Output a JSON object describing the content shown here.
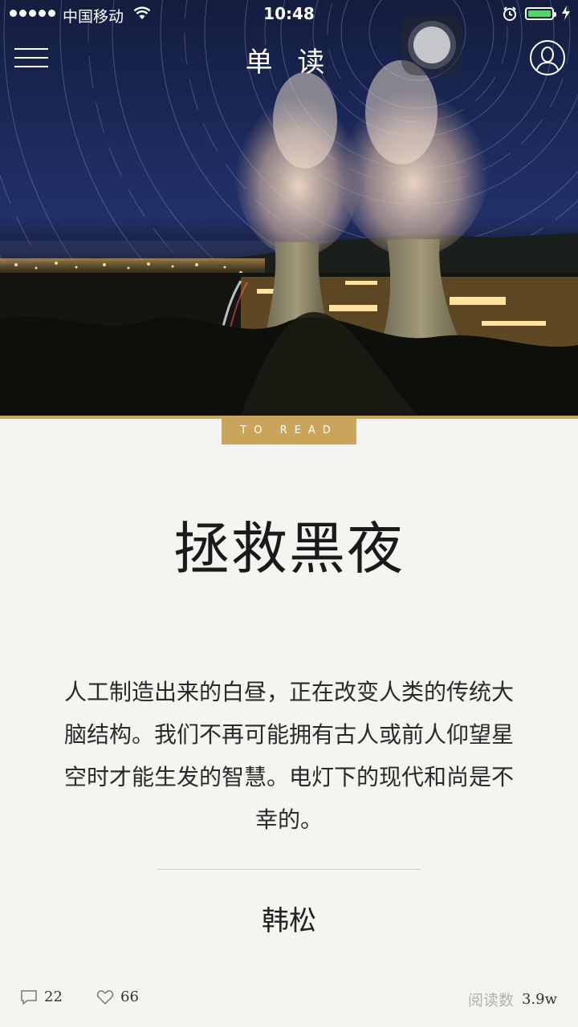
{
  "status_bar": {
    "carrier": "中国移动",
    "time": "10:48"
  },
  "header": {
    "app_title": "单 读"
  },
  "article": {
    "tag": "TO READ",
    "title": "拯救黑夜",
    "summary": "人工制造出来的白昼，正在改变人类的传统大脑结构。我们不再可能拥有古人或前人仰望星空时才能生发的智慧。电灯下的现代和尚是不幸的。",
    "author": "韩松"
  },
  "footer": {
    "comments": "22",
    "likes": "66",
    "reads_label": "阅读数",
    "reads_value": "3.9w"
  },
  "colors": {
    "accent_gold": "#c8a55a",
    "battery_green": "#4cd964",
    "background": "#f5f4f1"
  },
  "icons": [
    "menu-icon",
    "profile-icon",
    "comment-icon",
    "heart-icon",
    "wifi-icon",
    "alarm-icon",
    "charging-icon"
  ]
}
